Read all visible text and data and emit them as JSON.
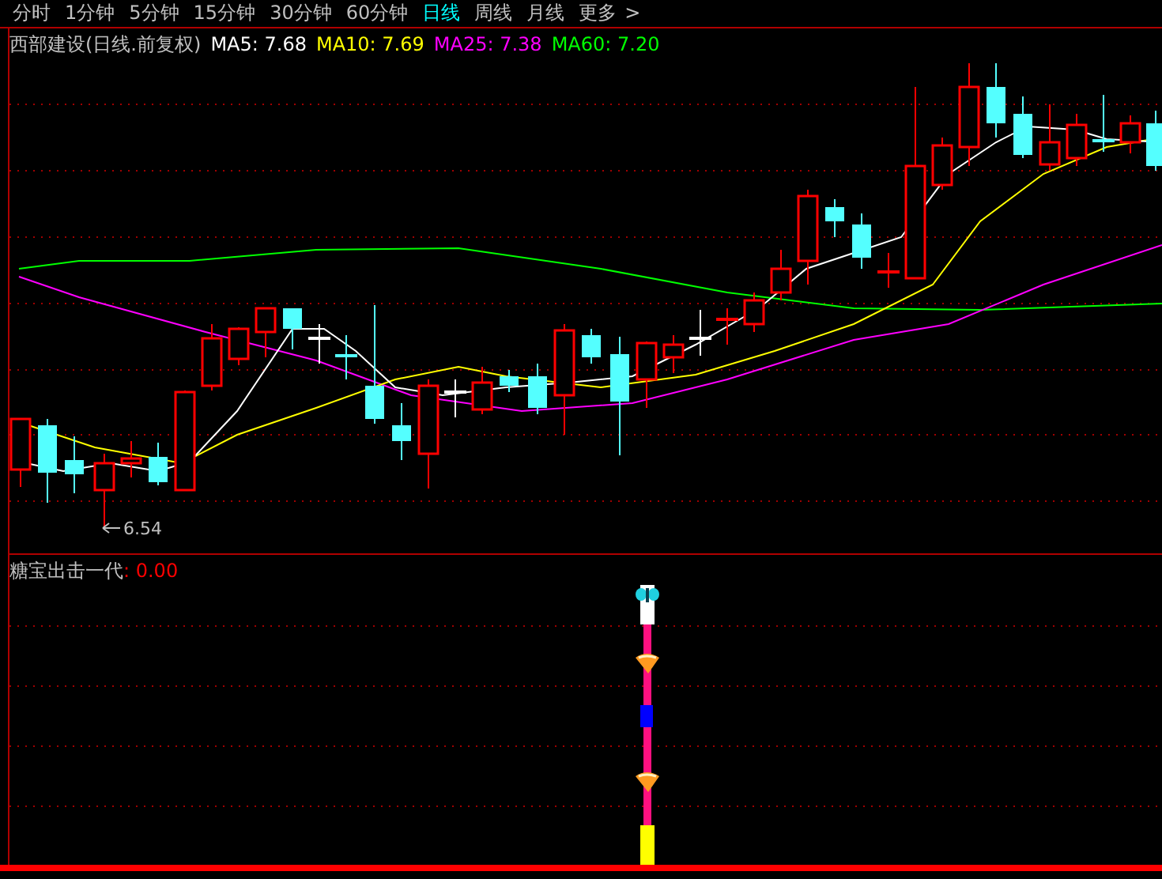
{
  "period_tabs": [
    {
      "label": "分时",
      "selected": false
    },
    {
      "label": "1分钟",
      "selected": false
    },
    {
      "label": "5分钟",
      "selected": false
    },
    {
      "label": "15分钟",
      "selected": false
    },
    {
      "label": "30分钟",
      "selected": false
    },
    {
      "label": "60分钟",
      "selected": false
    },
    {
      "label": "日线",
      "selected": true
    },
    {
      "label": "周线",
      "selected": false
    },
    {
      "label": "月线",
      "selected": false
    },
    {
      "label": "更多",
      "selected": false
    }
  ],
  "overflow_caret": ">",
  "main_chart": {
    "title": "西部建设(日线.前复权)",
    "indicators": [
      {
        "label": "MA5: 7.68",
        "color": "#ffffff"
      },
      {
        "label": "MA10: 7.69",
        "color": "#ffff00"
      },
      {
        "label": "MA25: 7.38",
        "color": "#ff00ff"
      },
      {
        "label": "MA60: 7.20",
        "color": "#00ff00"
      }
    ],
    "low_label": "6.54"
  },
  "sub_chart": {
    "title": "糖宝出击一代",
    "value": ": 0.00"
  }
}
